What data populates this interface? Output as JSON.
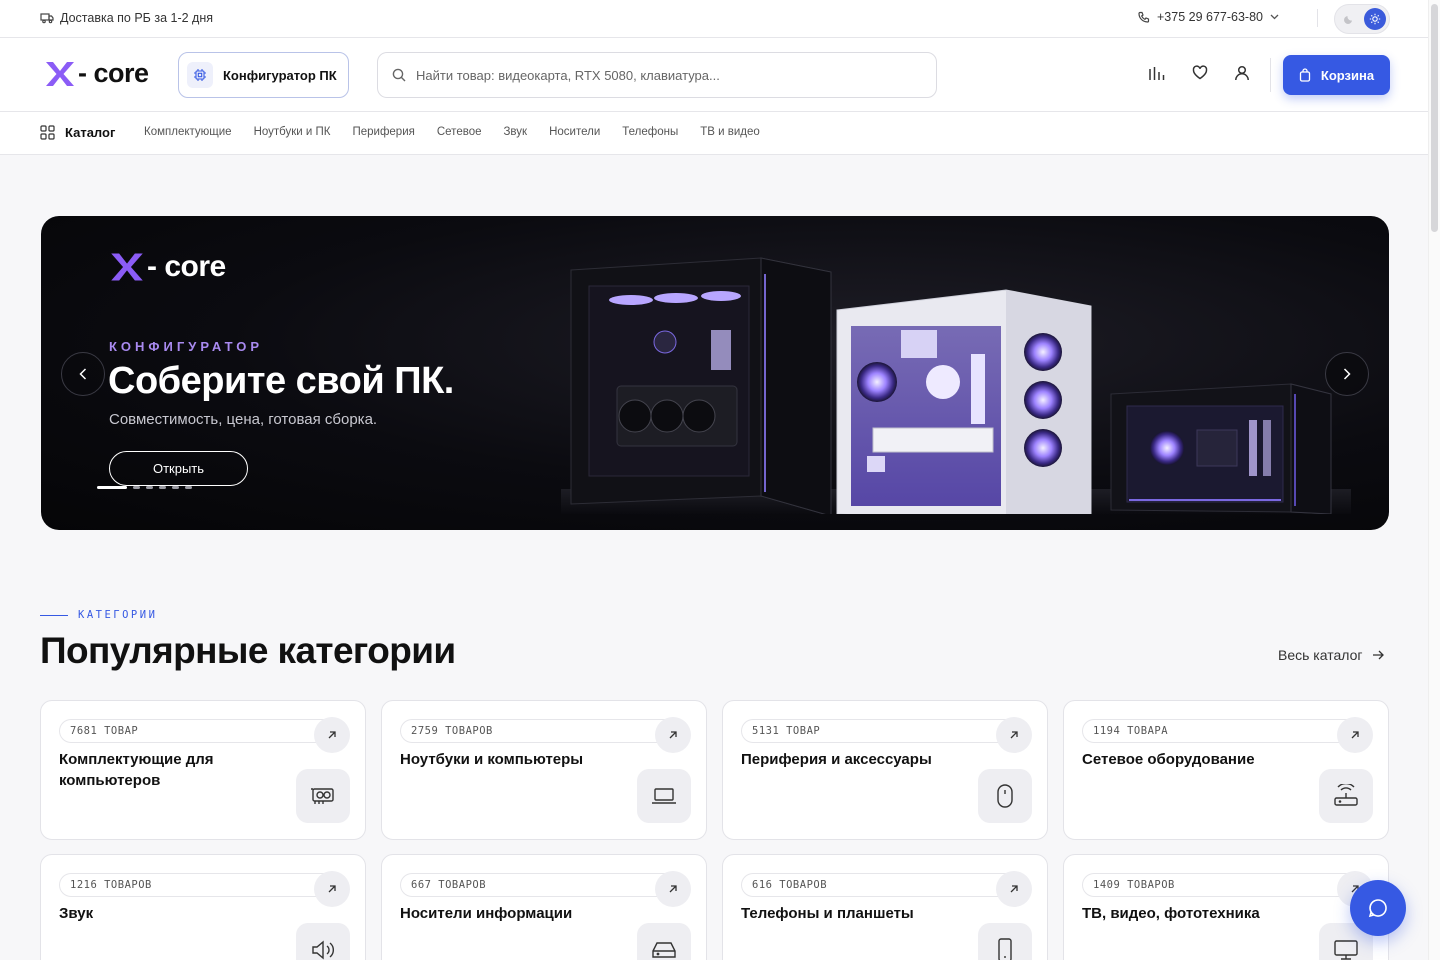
{
  "topbar": {
    "delivery": "Доставка по РБ за 1-2 дня",
    "phone": "+375 29 677-63-80"
  },
  "header": {
    "logo_text": "- core",
    "configurator_label": "Конфигуратор ПК",
    "search_placeholder": "Найти товар: видеокарта, RTX 5080, клавиатура...",
    "cart_label": "Корзина"
  },
  "nav": {
    "catalog_label": "Каталог",
    "links": [
      "Комплектующие",
      "Ноутбуки и ПК",
      "Периферия",
      "Сетевое",
      "Звук",
      "Носители",
      "Телефоны",
      "ТВ и видео"
    ]
  },
  "banner": {
    "logo_text": "- core",
    "eyebrow": "КОНФИГУРАТОР",
    "title": "Соберите свой ПК.",
    "subtitle": "Совместимость, цена, готовая сборка.",
    "button_label": "Открыть",
    "slides_count": 6,
    "active_slide": 1
  },
  "categories": {
    "eyebrow": "КАТЕГОРИИ",
    "title": "Популярные категории",
    "all_link": "Весь каталог",
    "items": [
      {
        "count": "7681 ТОВАР",
        "title": "Комплектующие для компьютеров",
        "icon": "gpu-icon"
      },
      {
        "count": "2759 ТОВАРОВ",
        "title": "Ноутбуки и компьютеры",
        "icon": "laptop-icon"
      },
      {
        "count": "5131 ТОВАР",
        "title": "Периферия и аксессуары",
        "icon": "mouse-icon"
      },
      {
        "count": "1194 ТОВАРА",
        "title": "Сетевое оборудование",
        "icon": "router-icon"
      },
      {
        "count": "1216 ТОВАРОВ",
        "title": "Звук",
        "icon": "speaker-icon"
      },
      {
        "count": "667 ТОВАРОВ",
        "title": "Носители информации",
        "icon": "drive-icon"
      },
      {
        "count": "616 ТОВАРОВ",
        "title": "Телефоны и планшеты",
        "icon": "phone-icon"
      },
      {
        "count": "1409 ТОВАРОВ",
        "title": "ТВ, видео, фототехника",
        "icon": "monitor-icon"
      }
    ]
  },
  "colors": {
    "accent": "#3659e3",
    "logo_x": "#8b5cf6",
    "banner_bg": "#0b0b10"
  }
}
